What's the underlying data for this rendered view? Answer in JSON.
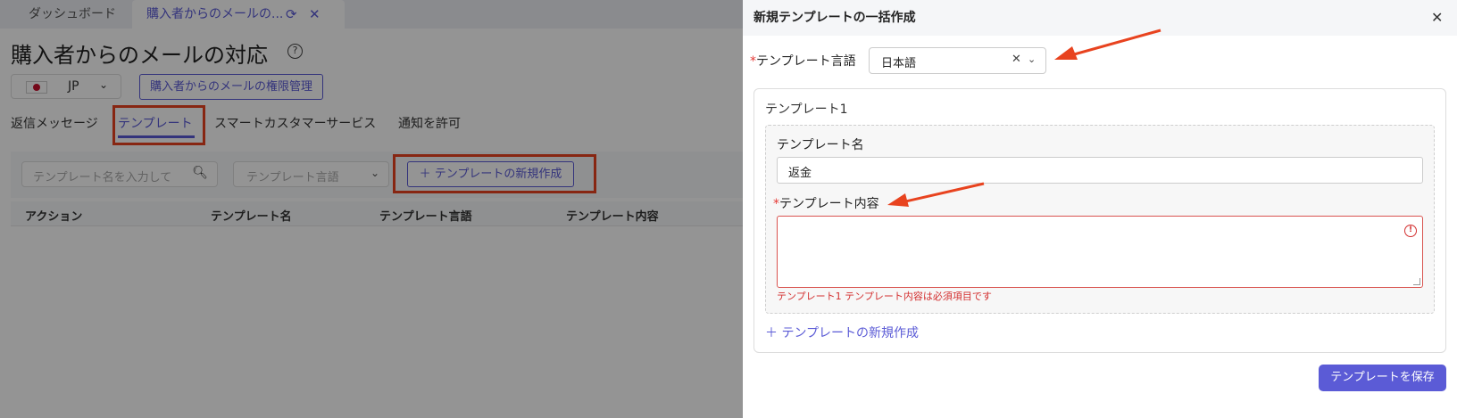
{
  "tabs": {
    "dashboard": "ダッシュボード",
    "active": "購入者からのメールの...",
    "refresh_icon": "refresh-icon",
    "close_icon": "close-icon"
  },
  "page": {
    "title": "購入者からのメールの対応",
    "help_icon": "?",
    "country_code": "JP",
    "permission_button": "購入者からのメールの権限管理"
  },
  "subtabs": [
    "返信メッセージ",
    "テンプレート",
    "スマートカスタマーサービス",
    "通知を許可"
  ],
  "filters": {
    "search_placeholder": "テンプレート名を入力して",
    "language_placeholder": "テンプレート言語",
    "new_template_button": "テンプレートの新規作成"
  },
  "table": {
    "columns": [
      "アクション",
      "テンプレート名",
      "テンプレート言語",
      "テンプレート内容"
    ]
  },
  "drawer": {
    "title": "新規テンプレートの一括作成",
    "required_mark": "*",
    "language_label": "テンプレート言語",
    "language_value": "日本語",
    "card_title": "テンプレート1",
    "name_label": "テンプレート名",
    "name_value": "返金",
    "content_label": "テンプレート内容",
    "error_icon": "!",
    "error_text": "テンプレート1 テンプレート内容は必須項目です",
    "add_link": "テンプレートの新規作成",
    "save_button": "テンプレートを保存"
  },
  "colors": {
    "accent": "#5b5bd6",
    "highlight": "#e8431f",
    "error": "#d32f2f"
  }
}
